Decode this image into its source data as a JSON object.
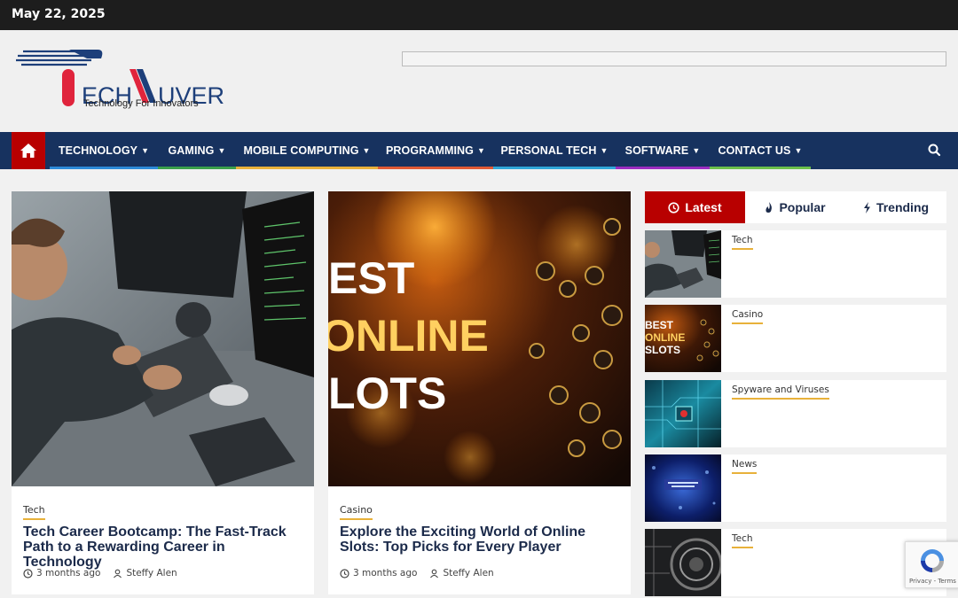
{
  "topbar": {
    "date": "May 22, 2025"
  },
  "logo": {
    "brand_left": "ECH",
    "brand_right": "UVER",
    "tagline": "Technology For Innovators"
  },
  "nav": {
    "items": [
      {
        "label": "TECHNOLOGY",
        "color": "#2d8ad8"
      },
      {
        "label": "GAMING",
        "color": "#3aa04a"
      },
      {
        "label": "MOBILE COMPUTING",
        "color": "#e8b13a"
      },
      {
        "label": "PROGRAMMING",
        "color": "#e05a35"
      },
      {
        "label": "PERSONAL TECH",
        "color": "#2fa7d8"
      },
      {
        "label": "SOFTWARE",
        "color": "#9b2cc0"
      },
      {
        "label": "CONTACT US",
        "color": "#6cc04a"
      }
    ]
  },
  "cards": [
    {
      "category": "Tech",
      "title": "Tech Career Bootcamp: The Fast-Track Path to a Rewarding Career in Technology",
      "time": "3 months ago",
      "author": "Steffy Alen"
    },
    {
      "category": "Casino",
      "title": "Explore the Exciting World of Online Slots: Top Picks for Every Player",
      "time": "3 months ago",
      "author": "Steffy Alen",
      "image_text": [
        "EST",
        "ONLINE",
        "LOTS"
      ]
    }
  ],
  "tabs": [
    {
      "label": "Latest",
      "icon": "clock-icon"
    },
    {
      "label": "Popular",
      "icon": "fire-icon"
    },
    {
      "label": "Trending",
      "icon": "bolt-icon"
    }
  ],
  "sidebar": {
    "items": [
      {
        "category": "Tech"
      },
      {
        "category": "Casino",
        "image_text": [
          "BEST",
          "ONLINE",
          "SLOTS"
        ]
      },
      {
        "category": "Spyware and Viruses"
      },
      {
        "category": "News"
      },
      {
        "category": "Tech"
      }
    ]
  },
  "recaptcha": {
    "links": "Privacy - Terms"
  },
  "colors": {
    "accent": "#b80000",
    "nav_bg": "#17325f",
    "underline": "#e8b13a"
  }
}
